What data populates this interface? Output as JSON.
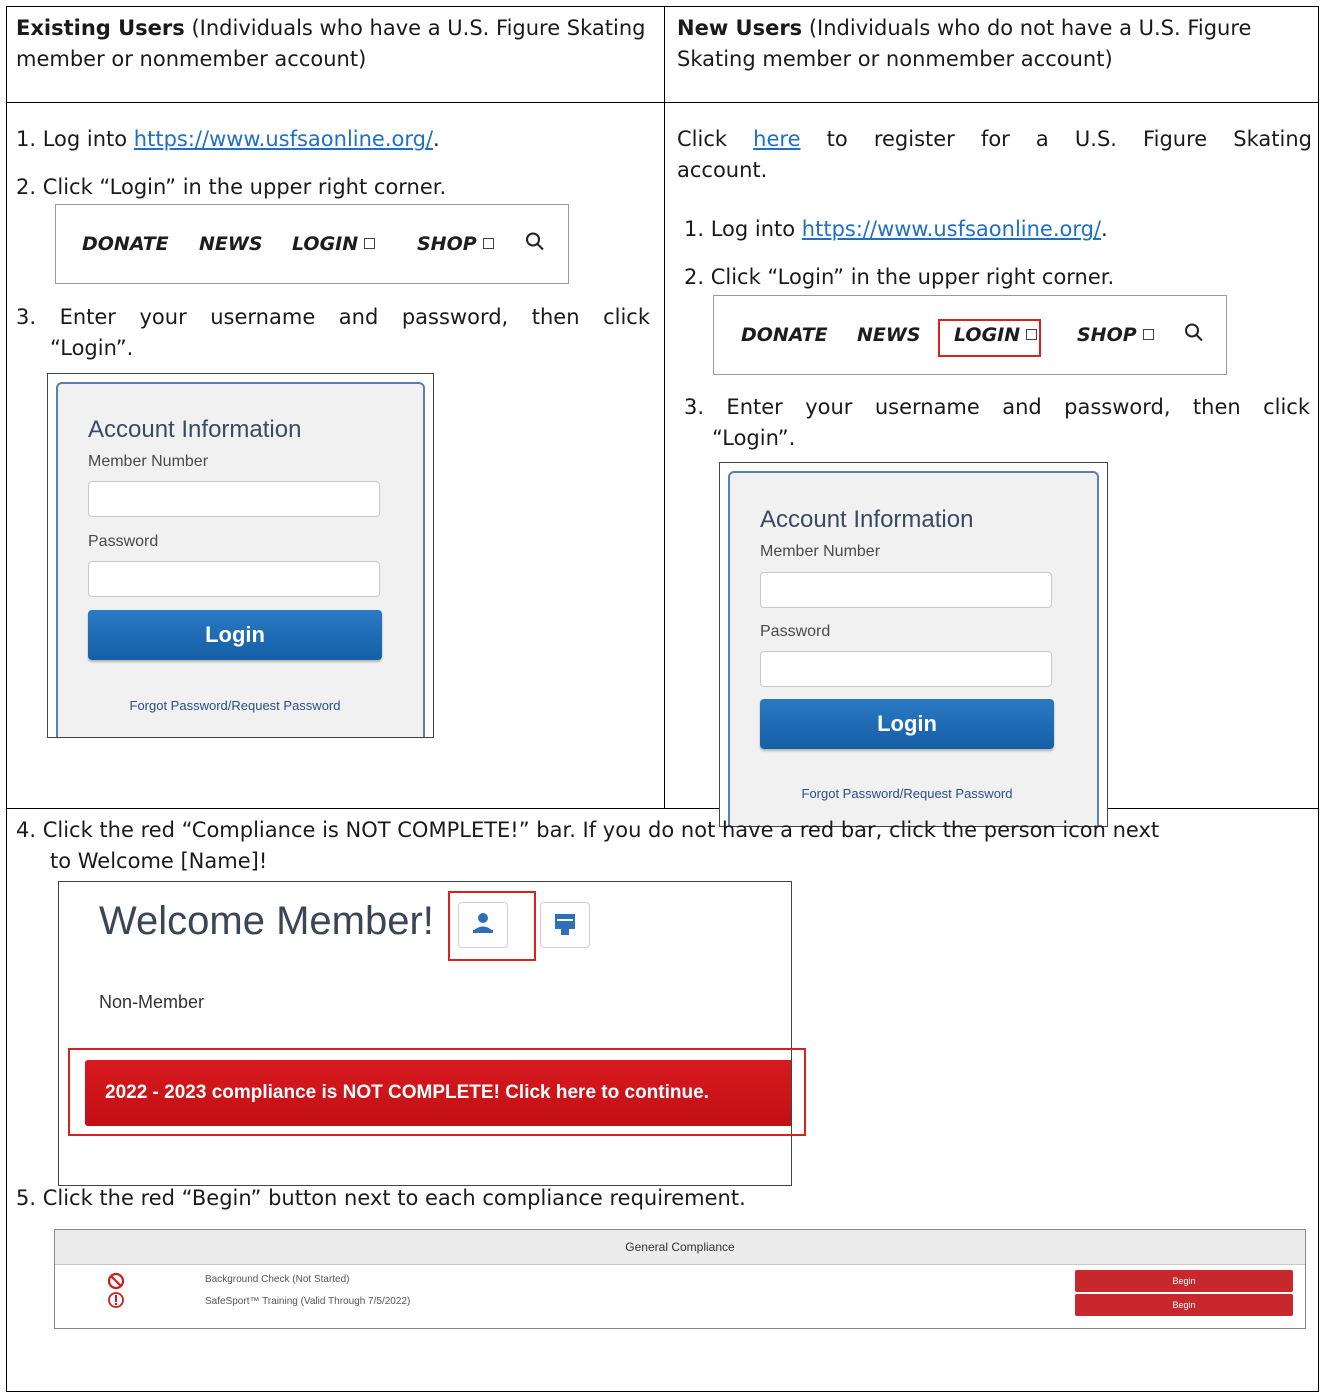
{
  "left_header": {
    "bold": "Existing Users",
    "rest": " (Individuals who have a U.S. Figure Skating member or nonmember account)"
  },
  "right_header": {
    "bold": "New Users",
    "rest": " (Individuals who do not have a U.S. Figure Skating member or nonmember account)"
  },
  "steps": {
    "s1_prefix": "1. Log into ",
    "s1_link": "https://www.usfsaonline.org/",
    "s1_suffix": ".",
    "s2": "2. Click “Login” in the upper right corner.",
    "s3_line1": "3. Enter your username and password, then click",
    "s3_line2": "“Login”.",
    "s4_line1": "4. Click the red “Compliance is NOT COMPLETE!” bar. If you do not have a red bar, click the person icon next",
    "s4_line2": "to Welcome [Name]!",
    "s5": "5. Click the red “Begin” button next to each compliance requirement."
  },
  "new_users": {
    "click": "Click",
    "here": "here",
    "register_rest": "to register for a U.S. Figure Skating",
    "account": "account."
  },
  "nav": {
    "donate": "DONATE",
    "news": "NEWS",
    "login": "LOGIN",
    "shop": "SHOP"
  },
  "login_card": {
    "title": "Account Information",
    "member_label": "Member Number",
    "password_label": "Password",
    "button": "Login",
    "forgot": "Forgot Password/Request Password"
  },
  "welcome": {
    "title": "Welcome Member!",
    "status": "Non-Member",
    "bar": "2022 - 2023 compliance is NOT COMPLETE! Click here to continue."
  },
  "compliance": {
    "header": "General Compliance",
    "rows": [
      {
        "label": "Background Check (Not Started)",
        "button": "Begin"
      },
      {
        "label": "SafeSport™ Training (Valid Through 7/5/2022)",
        "button": "Begin"
      }
    ]
  },
  "colors": {
    "link": "#1f6fc5",
    "highlight_box": "#d6231f",
    "login_button": "#1a6bb5",
    "compliance_bar": "#d01a1f"
  }
}
